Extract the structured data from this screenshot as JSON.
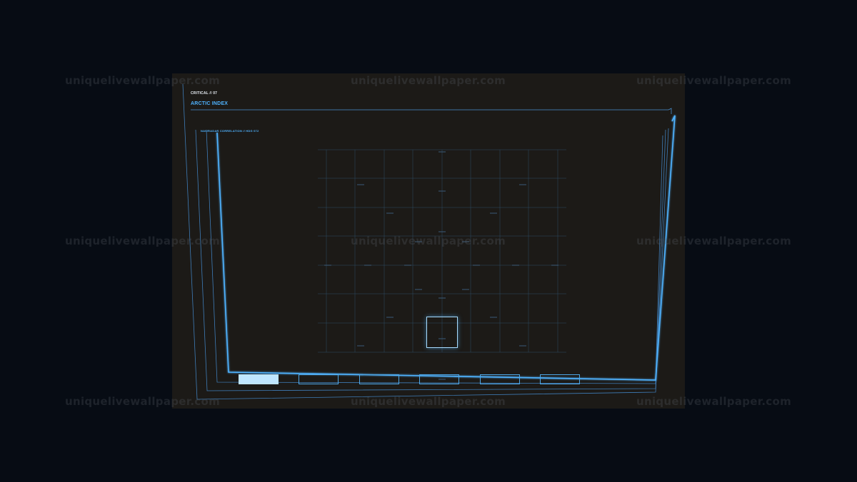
{
  "hud": {
    "status": "CRITICAL // 07",
    "title": "ARCTIC INDEX",
    "subtitle": "NAV/RADAR CORRELATION // HDG 072"
  },
  "watermark": {
    "text": "uniquelivewallpaper.com"
  },
  "tabs": [
    {
      "id": "tab-1",
      "active": true
    },
    {
      "id": "tab-2",
      "active": false
    },
    {
      "id": "tab-3",
      "active": false
    },
    {
      "id": "tab-4",
      "active": false
    },
    {
      "id": "tab-5",
      "active": false
    },
    {
      "id": "tab-6",
      "active": false
    }
  ],
  "colors": {
    "background": "#070c14",
    "panel": "#1c1a17",
    "accent": "#4fb3ff",
    "accent_light": "#bfe6ff",
    "grid": "#2c4a66"
  }
}
